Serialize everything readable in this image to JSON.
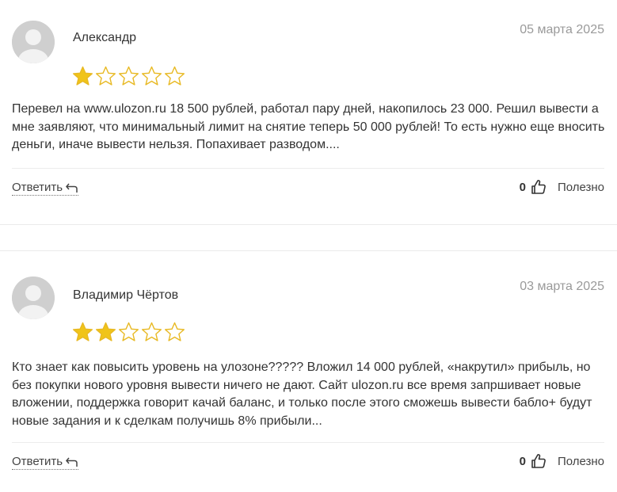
{
  "reviews": [
    {
      "author": "Александр",
      "date": "05 марта 2025",
      "rating": 1,
      "max_rating": 5,
      "text": "Перевел на www.ulozon.ru 18 500 рублей, работал пару дней, накопилось 23 000. Решил вывести а мне заявляют, что минимальный лимит на снятие теперь 50 000 рублей! То есть нужно еще вносить деньги, иначе вывести нельзя. Попахивает разводом....",
      "reply_label": "Ответить",
      "likes": "0",
      "helpful_label": "Полезно"
    },
    {
      "author": "Владимир Чёртов",
      "date": "03 марта 2025",
      "rating": 2,
      "max_rating": 5,
      "text": "Кто знает как повысить уровень на улозоне????? Вложил 14 000 рублей, «накрутил» прибыль, но без покупки нового уровня вывести ничего не дают. Сайт ulozon.ru все время запршивает новые вложении, поддержка говорит качай баланс, и только после этого сможешь вывести бабло+ будут новые задания и к сделкам получишь 8% прибыли...",
      "reply_label": "Ответить",
      "likes": "0",
      "helpful_label": "Полезно"
    }
  ],
  "colors": {
    "star_filled": "#f0c419",
    "star_outline": "#e8b923",
    "avatar_bg": "#d0d0d0",
    "date_text": "#9a9a9a"
  },
  "icons": {
    "avatar": "user-silhouette-icon",
    "star": "star-icon",
    "reply": "reply-arrow-icon",
    "helpful": "thumbs-up-icon"
  }
}
